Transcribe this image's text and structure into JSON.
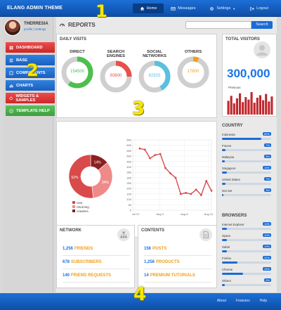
{
  "app": {
    "brand": "ELANG ADMIN THEME"
  },
  "topnav": [
    {
      "label": "Home",
      "icon": "home-icon",
      "active": true
    },
    {
      "label": "Messages",
      "icon": "envelope-icon",
      "active": false
    },
    {
      "label": "Settings",
      "icon": "gear-icon",
      "active": false
    },
    {
      "label": "Logout",
      "icon": "logout-icon",
      "active": false
    }
  ],
  "overlay_numbers": [
    "1",
    "2",
    "3",
    "4"
  ],
  "profile": {
    "name": "THERRESIA",
    "links": "profile | settings"
  },
  "sidebar": {
    "items": [
      {
        "label": "DASHBOARD",
        "color": "#d93333"
      },
      {
        "label": "BASE",
        "color": "#1a6cd6"
      },
      {
        "label": "COMPONENTS",
        "color": "#1a6cd6"
      },
      {
        "label": "CHARTS",
        "color": "#1a6cd6"
      },
      {
        "label": "WIDGETS & SAMPLES",
        "color": "#d93333"
      },
      {
        "label": "TEMPLATE HELP",
        "color": "#4caf50"
      }
    ]
  },
  "header": {
    "title": "REPORTS",
    "search_placeholder": "",
    "search_button": "Search"
  },
  "daily_visits": {
    "title": "DAILY VISITS",
    "items": [
      {
        "label": "DIRECT",
        "value": "154500",
        "percent": 0.6,
        "color": "#4cc04c"
      },
      {
        "label": "SEARCH ENGINES",
        "value": "93600",
        "percent": 0.25,
        "color": "#e8504a"
      },
      {
        "label": "SOCIAL NETWORKS",
        "value": "82925",
        "percent": 0.42,
        "color": "#5bc0de"
      },
      {
        "label": "OTHERS",
        "value": "17600",
        "percent": 0.06,
        "color": "#f0a018"
      }
    ]
  },
  "chart_data": [
    {
      "type": "pie",
      "title": "",
      "categories": [
        "new",
        "returning",
        "crawlers"
      ],
      "values": [
        52,
        34,
        14
      ],
      "labels": [
        "52%",
        "34%",
        "14%"
      ],
      "colors": [
        "#d94a4a",
        "#ef8a8a",
        "#8b1f1f"
      ]
    },
    {
      "type": "line",
      "title": "",
      "x_tick_labels": [
        "Jul 21",
        "Aug 4",
        "Aug 8",
        "Aug 12"
      ],
      "y_tick_labels": [
        "0",
        "50",
        "100",
        "150",
        "200",
        "250",
        "300",
        "350",
        "400",
        "450",
        "500",
        "550",
        "600",
        "650"
      ],
      "ylim": [
        0,
        650
      ],
      "values": [
        570,
        560,
        480,
        510,
        520,
        390,
        340,
        300,
        150,
        160,
        150,
        190,
        140,
        270,
        180
      ],
      "color": "#d94a4a",
      "grid": true
    },
    {
      "type": "bar",
      "title": "",
      "values": [
        22,
        30,
        18,
        26,
        34,
        20,
        28,
        24,
        36,
        19,
        27,
        31,
        23,
        33,
        21,
        29
      ],
      "color": "#c0282e"
    }
  ],
  "network": {
    "title": "NETWORK",
    "icon": "sitemap-icon",
    "rows": [
      {
        "num": "1,256",
        "text": "FRIENDS"
      },
      {
        "num": "678",
        "text": "SUBSCRIBERS"
      },
      {
        "num": "140",
        "text": "FRIEND REQUESTS"
      }
    ]
  },
  "contents": {
    "title": "CONTENTS",
    "icon": "document-icon",
    "rows": [
      {
        "num": "156",
        "text": "POSTS"
      },
      {
        "num": "1,256",
        "text": "PRODUCTS"
      },
      {
        "num": "14",
        "text": "PREMIUM TUTORIALS"
      }
    ]
  },
  "total_visitors": {
    "title": "TOTAL VISITORS",
    "value": "300,000",
    "previous_label": "Previous",
    "icon": "user-icon"
  },
  "country": {
    "title": "COUNTRY",
    "items": [
      {
        "name": "Indonesia",
        "pct": "80%",
        "value": 0.8
      },
      {
        "name": "France",
        "pct": "7%",
        "value": 0.07
      },
      {
        "name": "Malaysia",
        "pct": "5%",
        "value": 0.05
      },
      {
        "name": "Singapore",
        "pct": "10%",
        "value": 0.1
      },
      {
        "name": "United States",
        "pct": "7%",
        "value": 0.07
      },
      {
        "name": "Not Set",
        "pct": "3%",
        "value": 0.03
      }
    ]
  },
  "browsers": {
    "title": "BROWSERS",
    "items": [
      {
        "name": "Internet Explorer",
        "pct": "10%",
        "value": 0.1
      },
      {
        "name": "Opera",
        "pct": "10%",
        "value": 0.1
      },
      {
        "name": "Safari",
        "pct": "10%",
        "value": 0.1
      },
      {
        "name": "Firefox",
        "pct": "31%",
        "value": 0.31
      },
      {
        "name": "Chrome",
        "pct": "43%",
        "value": 0.43
      },
      {
        "name": "Others",
        "pct": "6%",
        "value": 0.06
      }
    ]
  },
  "footer": {
    "links": [
      "About",
      "Features",
      "Help"
    ]
  }
}
